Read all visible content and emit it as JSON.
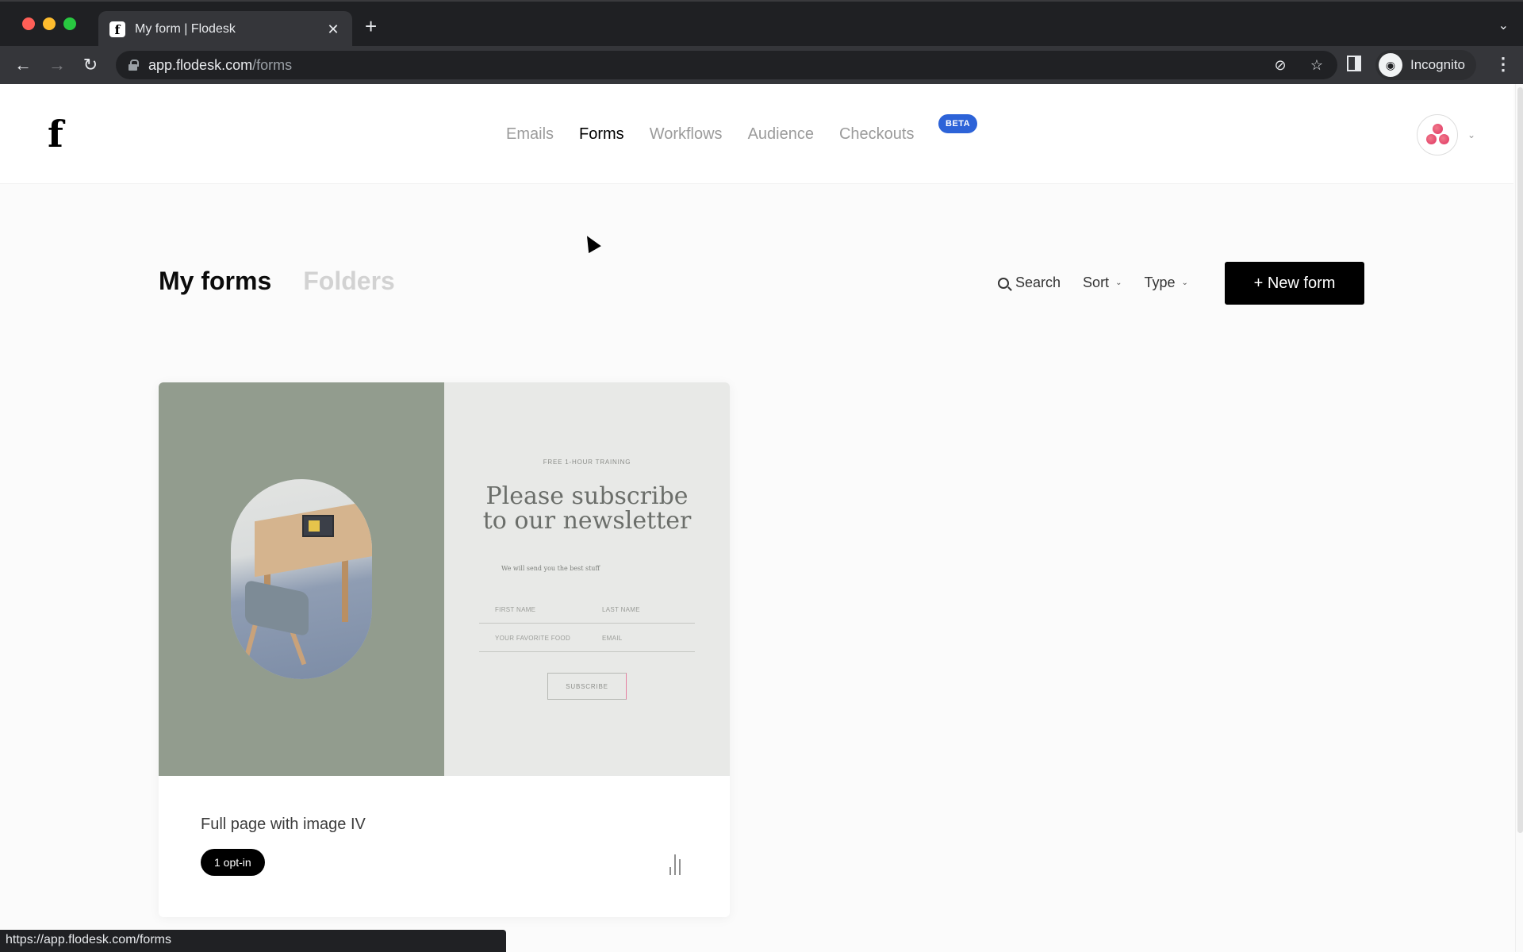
{
  "browser": {
    "tab": {
      "title": "My form | Flodesk",
      "favicon": "flodesk-f-icon"
    },
    "url": {
      "host": "app.flodesk.com",
      "path": "/forms"
    },
    "profile_label": "Incognito",
    "status_url": "https://app.flodesk.com/forms",
    "icons": {
      "back": "←",
      "forward": "→",
      "reload": "↻",
      "new_tab": "+",
      "close_tab": "✕",
      "tab_list": "⌄",
      "eye_off": "⊘",
      "star": "☆",
      "menu": "⋮",
      "incognito": "◉"
    }
  },
  "header": {
    "logo": "f",
    "nav": [
      {
        "label": "Emails",
        "active": false
      },
      {
        "label": "Forms",
        "active": true
      },
      {
        "label": "Workflows",
        "active": false
      },
      {
        "label": "Audience",
        "active": false
      },
      {
        "label": "Checkouts",
        "active": false
      }
    ],
    "beta_badge": "BETA",
    "avatar_caret": "⌄"
  },
  "page": {
    "tabs": [
      {
        "label": "My forms",
        "active": true
      },
      {
        "label": "Folders",
        "active": false
      }
    ],
    "actions": {
      "search": "Search",
      "sort": "Sort",
      "type": "Type",
      "caret": "⌄"
    },
    "new_form_button": "+ New form"
  },
  "forms": [
    {
      "name": "Full page with image IV",
      "optins": "1 opt-in",
      "preview": {
        "background_left": "#929c8e",
        "background_right": "#e8e9e7",
        "eyebrow": "FREE 1-HOUR TRAINING",
        "title": "Please subscribe to our newsletter",
        "subtitle": "We will send you the best stuff",
        "fields": [
          "FIRST NAME",
          "LAST NAME",
          "YOUR FAVORITE FOOD",
          "EMAIL"
        ],
        "button": "SUBSCRIBE"
      }
    }
  ],
  "colors": {
    "brand_black": "#000000",
    "beta_blue": "#2d63d8",
    "avatar_pink": "#e03262",
    "nav_inactive": "#9b9b9b"
  }
}
